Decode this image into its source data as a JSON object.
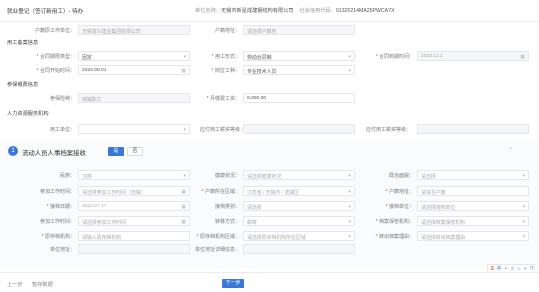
{
  "header": {
    "title": "就业登记（签订新用工）- 待办",
    "unit_label": "单位名称：",
    "unit_name": "无锡市新星成建钢结构有限公司",
    "credit_label": "社会信用代码：",
    "credit_code": "91320214MA25PWCA7X"
  },
  "top": {
    "orig_unit_label": "户籍原工作单位：",
    "orig_unit_placeholder": "无锡富兴建业集团有限公司",
    "hukou_label": "户籍地址：",
    "hukou_placeholder": "请选择户籍地"
  },
  "contract": {
    "section_title": "用工备案信息",
    "type_label": "合同期限类型：",
    "type_value": "固定",
    "hire_label": "用工形式：",
    "hire_value": "劳动合同制",
    "end_label": "合同到期时间：",
    "end_value": "2023.12.2",
    "start_label": "合同开始时间：",
    "start_value": "2024.09.01",
    "post_label": "岗位工种：",
    "post_value": "专业技术人员"
  },
  "insurance": {
    "section_title": "参保缴费信息",
    "type_label": "参保险种：",
    "type_value": "城镇职工",
    "wage_label": "月缴费工资：",
    "wage_value": "6,000.00"
  },
  "hr": {
    "section_title": "人力资源服务机构",
    "org_label": "用工单位：",
    "fee_label": "应付用工薪资等级：",
    "place_label": "应付用工薪资等级："
  },
  "migrant": {
    "number": "1",
    "title": "流动人员人事档案接收",
    "yes_label": "是",
    "no_label": "否",
    "fields": [
      {
        "label": "民族：",
        "value": "汉族",
        "req": false,
        "icon": "▾"
      },
      {
        "label": "健康状况：",
        "value": "请选择健康状况",
        "req": false,
        "icon": "▾"
      },
      {
        "label": "政治面貌：",
        "value": "请选择",
        "req": false,
        "icon": "▾"
      },
      {
        "label": "参加工作时间：",
        "value": "请选择参加工作时间（选填）",
        "req": false,
        "icon": "▦"
      },
      {
        "label": "户籍所在区域：",
        "value": "江苏省 / 无锡市 / 滨湖区",
        "req": true,
        "icon": "▾"
      },
      {
        "label": "户籍地址：",
        "value": "请填写户籍",
        "req": true,
        "icon": ""
      },
      {
        "label": "接档日期：",
        "value": "2024.07.17",
        "req": true,
        "icon": "▦"
      },
      {
        "label": "接档类别：",
        "value": "请选择",
        "req": false,
        "icon": "▾"
      },
      {
        "label": "接档单位：",
        "value": "请选择接档单位",
        "req": true,
        "icon": "▾"
      },
      {
        "label": "参加工作时间：",
        "value": "请选择参加工作时间",
        "req": false,
        "icon": "▦"
      },
      {
        "label": "转移方式：",
        "value": "邮寄",
        "req": false,
        "icon": "▾"
      },
      {
        "label": "档案保管机构：",
        "value": "请选择档案保管机构",
        "req": true,
        "icon": "▾"
      },
      {
        "label": "原存档机构：",
        "value": "请输入原存档机构",
        "req": true,
        "icon": ""
      },
      {
        "label": "原存档机构区域：",
        "value": "请选择原存档机构所在区域",
        "req": true,
        "icon": "▾"
      },
      {
        "label": "转出档案理由：",
        "value": "请选择转出档案理由",
        "req": true,
        "icon": "▾"
      }
    ],
    "addr_label": "单位地址：",
    "detail_label": "单位地址详细信息："
  },
  "footer": {
    "prev_label": "上一步",
    "save_label": "暂存数据",
    "next_label": "下一步"
  },
  "float_toolbar": [
    "S",
    "中",
    "•",
    "ↄ",
    "♪",
    "▪",
    "⠿"
  ]
}
